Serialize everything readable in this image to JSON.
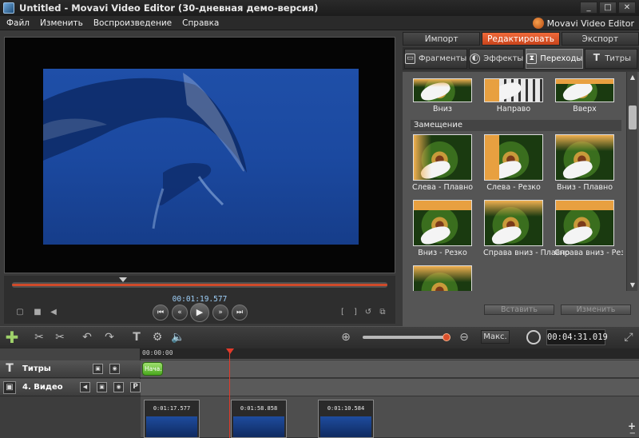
{
  "window": {
    "title": "Untitled - Movavi Video Editor (30-дневная демо-версия)",
    "controls": [
      "_",
      "□",
      "✕"
    ]
  },
  "menu": [
    "Файл",
    "Изменить",
    "Воспроизведение",
    "Справка"
  ],
  "brand": "Movavi Video Editor",
  "player": {
    "current_time": "00:01:19.577",
    "scrub_progress": 1.0
  },
  "top_tabs": [
    "Импорт",
    "Редактировать",
    "Экспорт"
  ],
  "active_top_tab": "Редактировать",
  "sub_tabs": [
    "Фрагменты",
    "Эффекты",
    "Переходы",
    "Титры"
  ],
  "active_sub_tab": "Переходы",
  "transitions_top": [
    "Вниз",
    "Направо",
    "Вверх"
  ],
  "section_title": "Замещение",
  "transitions": [
    "Слева - Плавно",
    "Слева - Резко",
    "Вниз - Плавно",
    "Вниз - Резко",
    "Справа вниз - Плавно",
    "Справа вниз - Резко"
  ],
  "panel_buttons": {
    "insert": "Вставить",
    "change": "Изменить"
  },
  "toolbar": {
    "max_label": "Макс.",
    "total_time": "00:04:31.019"
  },
  "timeline": {
    "ruler_start": "00:00:00",
    "tracks": [
      {
        "icon": "T",
        "name": "Титры"
      },
      {
        "icon": "▣",
        "name": "4. Видео"
      }
    ],
    "title_clip": "Нача...",
    "video_clips": [
      "0:01:17.577",
      "0:01:58.858",
      "0:01:10.584"
    ]
  },
  "colors": {
    "accent": "#e8542a",
    "playhead": "#e23a2a",
    "title_clip": "#6cc43a"
  }
}
